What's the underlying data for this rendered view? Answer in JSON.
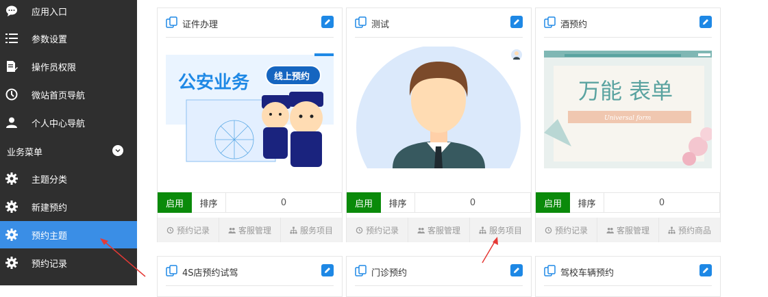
{
  "sidebar": {
    "items": [
      {
        "label": "应用入口",
        "icon": "chat-bubble-icon"
      },
      {
        "label": "参数设置",
        "icon": "list-settings-icon"
      },
      {
        "label": "操作员权限",
        "icon": "document-edit-icon"
      },
      {
        "label": "微站首页导航",
        "icon": "clock-icon"
      },
      {
        "label": "个人中心导航",
        "icon": "user-icon"
      }
    ],
    "section_label": "业务菜单",
    "section_items": [
      {
        "label": "主题分类",
        "icon": "gear-icon"
      },
      {
        "label": "新建预约",
        "icon": "gear-icon"
      },
      {
        "label": "预约主题",
        "icon": "gear-icon",
        "active": true
      },
      {
        "label": "预约记录",
        "icon": "gear-icon"
      }
    ]
  },
  "cards": [
    {
      "title": "证件办理",
      "image_text": "公安业务",
      "image_badge": "线上预约",
      "status_label": "启用",
      "sort_label": "排序",
      "sort_value": "0",
      "actions": [
        "预约记录",
        "客服管理",
        "服务项目"
      ]
    },
    {
      "title": "测试",
      "status_label": "启用",
      "sort_label": "排序",
      "sort_value": "0",
      "actions": [
        "预约记录",
        "客服管理",
        "服务项目"
      ]
    },
    {
      "title": "酒预约",
      "image_text": "万能 表单",
      "image_subtext": "Universal form",
      "status_label": "启用",
      "sort_label": "排序",
      "sort_value": "0",
      "actions": [
        "预约记录",
        "客服管理",
        "预约商品"
      ]
    },
    {
      "title": "4S店预约试驾"
    },
    {
      "title": "门诊预约"
    },
    {
      "title": "驾校车辆预约"
    }
  ],
  "colors": {
    "sidebar_bg": "#2f2f2f",
    "active_bg": "#3a8ee6",
    "enable_green": "#0a8a0a",
    "edit_blue": "#1e88e5",
    "annotation_red": "#e53935"
  }
}
